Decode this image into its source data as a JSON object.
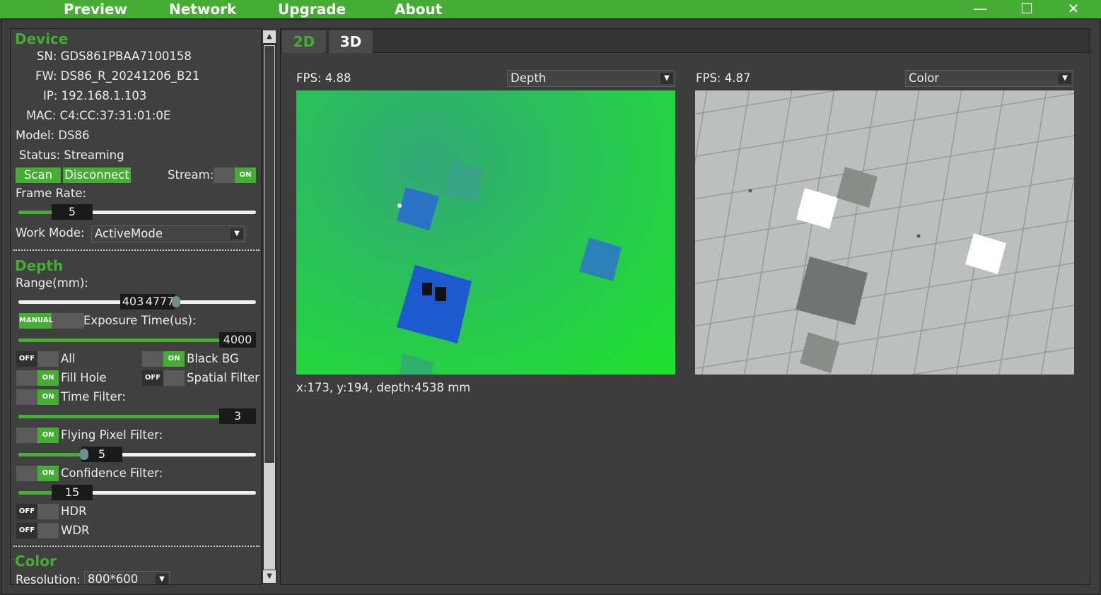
{
  "menu": {
    "preview": "Preview",
    "network": "Network",
    "upgrade": "Upgrade",
    "about": "About"
  },
  "window": {
    "minimize": "—",
    "maximize": "☐",
    "close": "✕"
  },
  "device": {
    "title": "Device",
    "sn": "SN: GDS861PBAA7100158",
    "fw": "FW: DS86_R_20241206_B21",
    "ip": "IP: 192.168.1.103",
    "mac": "MAC: C4:CC:37:31:01:0E",
    "model": "Model: DS86",
    "status": "Status: Streaming",
    "scan": "Scan",
    "disconnect": "Disconnect",
    "stream_label": "Stream:",
    "stream_state": "ON",
    "frame_rate_label": "Frame Rate:",
    "frame_rate_value": "5",
    "work_mode_label": "Work Mode:",
    "work_mode_value": "ActiveMode"
  },
  "depth": {
    "title": "Depth",
    "range_label": "Range(mm):",
    "range_min": "403",
    "range_max": "4777",
    "exposure_mode": "MANUAL",
    "exposure_label": "Exposure Time(us):",
    "exposure_value": "4000",
    "all_label": "All",
    "all_state": "OFF",
    "black_bg_label": "Black BG",
    "black_bg_state": "ON",
    "fill_hole_label": "Fill Hole",
    "fill_hole_state": "ON",
    "spatial_label": "Spatial Filter",
    "spatial_state": "OFF",
    "time_filter_label": "Time Filter:",
    "time_filter_state": "ON",
    "time_filter_value": "3",
    "flying_label": "Flying Pixel Filter:",
    "flying_state": "ON",
    "flying_value": "5",
    "confidence_label": "Confidence Filter:",
    "confidence_state": "ON",
    "confidence_value": "15",
    "hdr_label": "HDR",
    "hdr_state": "OFF",
    "wdr_label": "WDR",
    "wdr_state": "OFF"
  },
  "color": {
    "title": "Color",
    "resolution_label": "Resolution:",
    "resolution_value": "800*600"
  },
  "tabs": {
    "t2d": "2D",
    "t3d": "3D"
  },
  "left_view": {
    "fps": "FPS: 4.88",
    "mode": "Depth",
    "coords": "x:173, y:194, depth:4538 mm"
  },
  "right_view": {
    "fps": "FPS: 4.87",
    "mode": "Color"
  },
  "colors": {
    "accent": "#45ad33",
    "background": "#3d3d3d"
  }
}
